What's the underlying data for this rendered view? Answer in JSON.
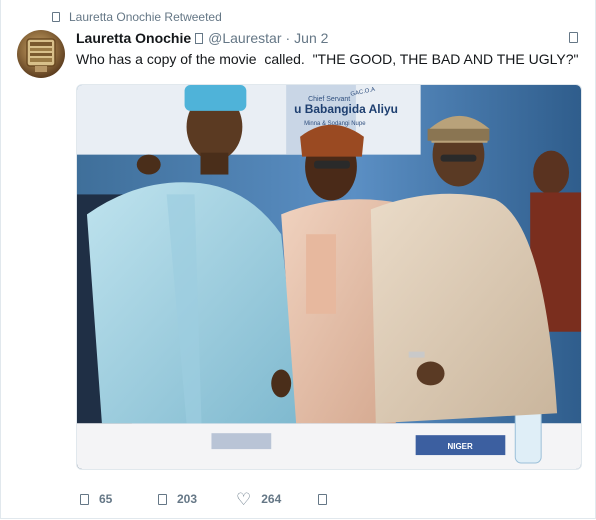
{
  "retweet": {
    "label": "Lauretta Onochie Retweeted",
    "icon": "retweet-icon"
  },
  "author": {
    "name": "Lauretta Onochie",
    "verified_icon": "verified-icon",
    "handle": "@Laurestar",
    "separator": "·",
    "date": "Jun 2"
  },
  "tweet": {
    "text": "Who has a copy of the movie  called.  \"THE GOOD, THE BAD AND THE UGLY?\""
  },
  "media": {
    "banner_text_1": "Chief Servant",
    "banner_text_2": "u Babangida Aliyu",
    "banner_text_3": "Minna & Sodangi Nupe",
    "banner_text_4": "GAC.O.A",
    "desk_sign": "NIGER"
  },
  "actions": {
    "reply_count": "65",
    "retweet_count": "203",
    "like_count": "264",
    "reply_icon": "reply-icon",
    "retweet_icon": "retweet-icon",
    "like_icon": "heart-icon",
    "dm_icon": "message-icon"
  },
  "colors": {
    "muted": "#657786",
    "text": "#14171a",
    "border": "#e1e8ed"
  }
}
